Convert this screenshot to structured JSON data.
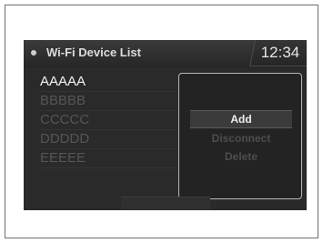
{
  "header": {
    "title": "Wi-Fi Device List",
    "clock": "12:34",
    "icon": "settings-dot-icon"
  },
  "device_list": {
    "items": [
      {
        "label": "AAAAA",
        "selected": true
      },
      {
        "label": "BBBBB",
        "selected": false
      },
      {
        "label": "CCCCC",
        "selected": false
      },
      {
        "label": "DDDDD",
        "selected": false
      },
      {
        "label": "EEEEE",
        "selected": false
      }
    ]
  },
  "popup_menu": {
    "add_label": "Add",
    "disconnect_label": "Disconnect",
    "delete_label": "Delete"
  },
  "colors": {
    "screen_background": "#2a2a2a",
    "selected_text": "#f2f2f2",
    "dimmed_text": "#555555",
    "popup_border": "#b8b8b8"
  }
}
